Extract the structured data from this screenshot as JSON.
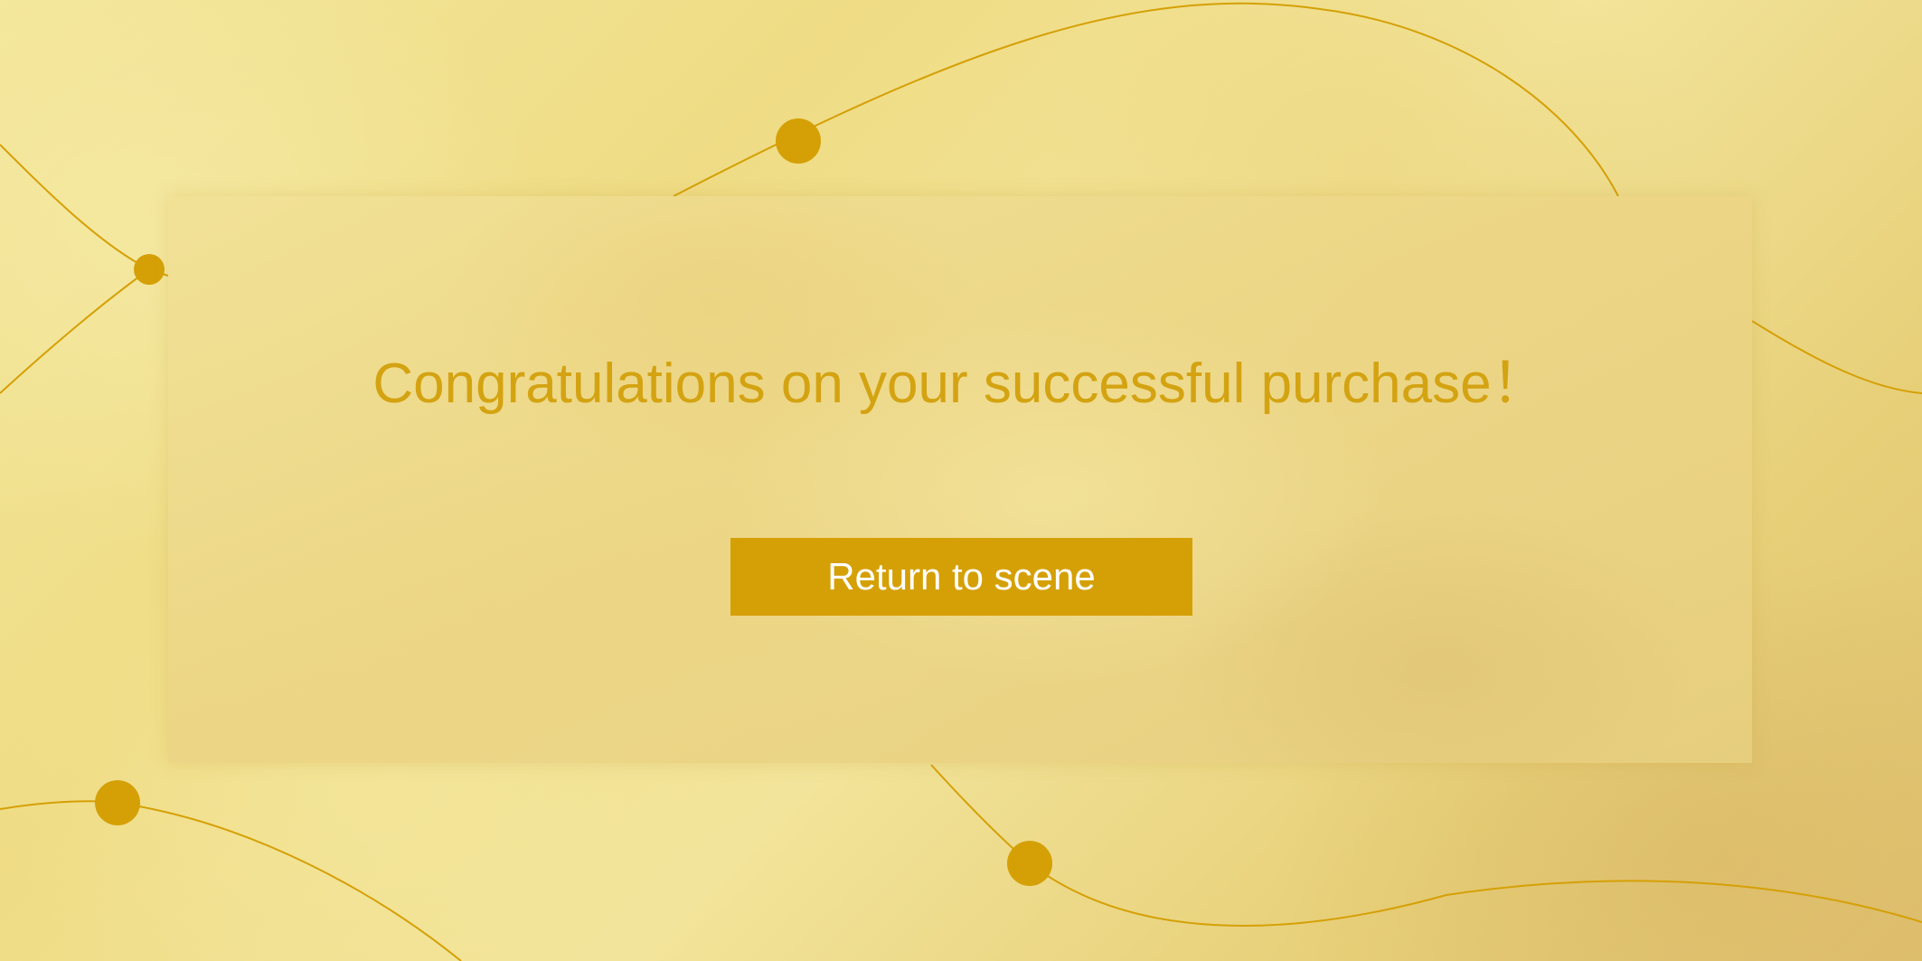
{
  "dialog": {
    "message": "Congratulations on your successful purchase！",
    "return_button_label": "Return to scene"
  },
  "colors": {
    "accent": "#d5a006",
    "message_text": "#d4a312",
    "button_text": "#ffffff",
    "background": "#f0e08f"
  }
}
